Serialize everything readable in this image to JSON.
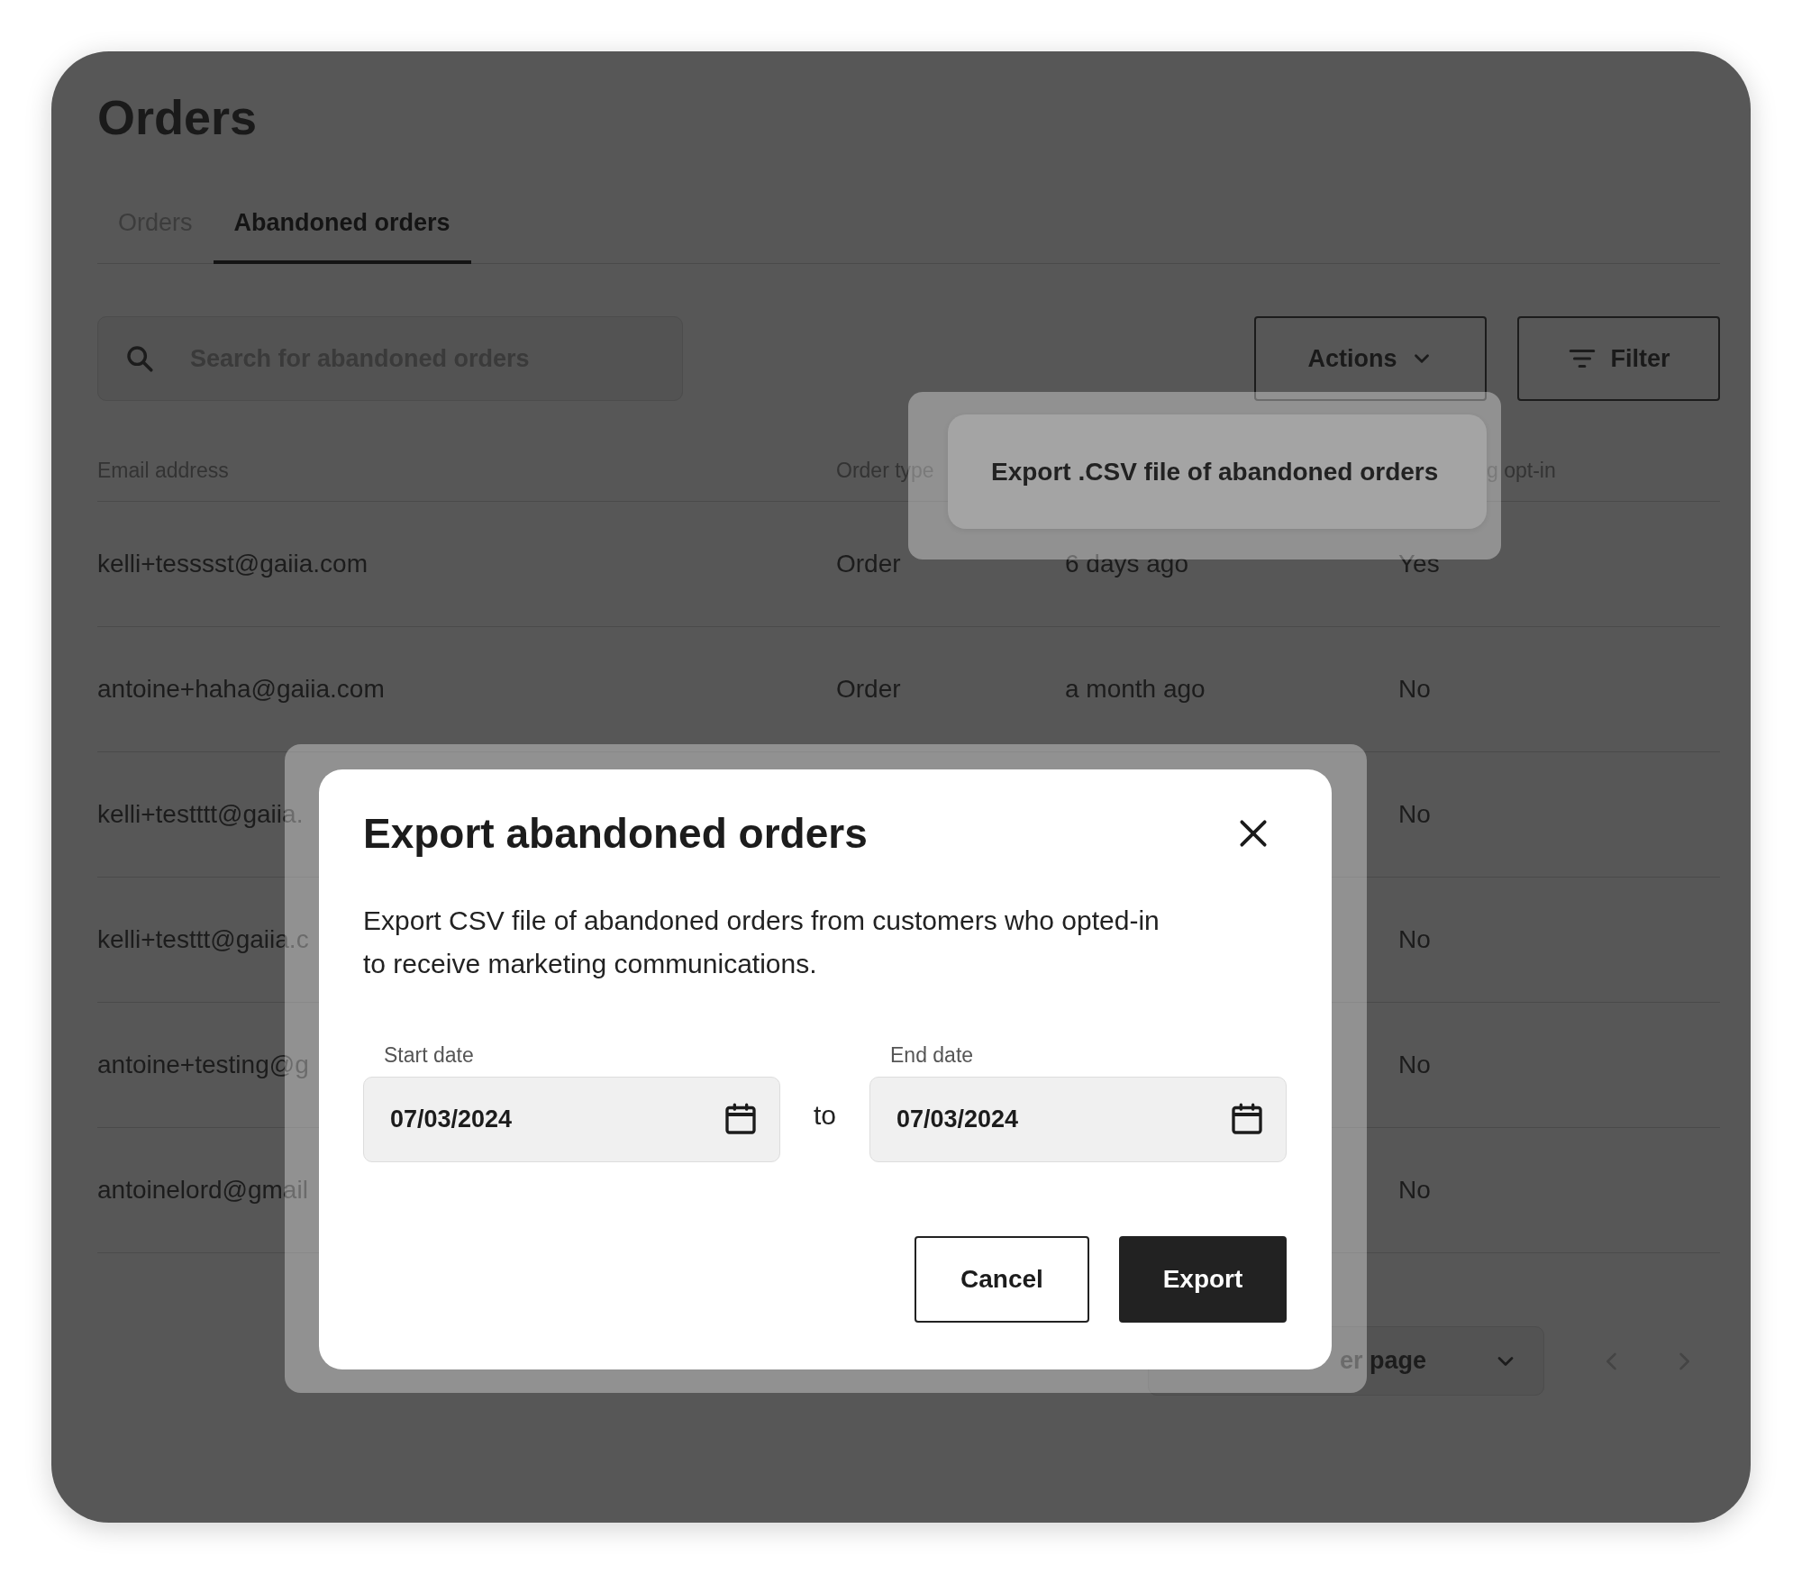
{
  "page": {
    "title": "Orders"
  },
  "tabs": [
    {
      "label": "Orders",
      "selected": false
    },
    {
      "label": "Abandoned orders",
      "selected": true
    }
  ],
  "search": {
    "placeholder": "Search for abandoned orders"
  },
  "toolbar": {
    "actions_button": "Actions",
    "filter_button": "Filter"
  },
  "actions_menu": {
    "items": [
      "Export .CSV file of abandoned orders"
    ]
  },
  "table": {
    "header": {
      "email": "Email address",
      "order_type": "Order type",
      "column_4": "g opt-in"
    },
    "rows": [
      {
        "email": "kelli+tesssst@gaiia.com",
        "order_type": "Order",
        "date": "6 days ago",
        "opt_in": "Yes"
      },
      {
        "email": "antoine+haha@gaiia.com",
        "order_type": "Order",
        "date": "a month ago",
        "opt_in": "No"
      },
      {
        "email": "kelli+testttt@gaiia.",
        "opt_in": "No"
      },
      {
        "email": "kelli+testtt@gaiia.c",
        "opt_in": "No"
      },
      {
        "email": "antoine+testing@g",
        "opt_in": "No"
      },
      {
        "email": "antoinelord@gmail",
        "opt_in": "No"
      }
    ]
  },
  "pagination": {
    "per_page": "er page"
  },
  "dialog": {
    "title": "Export abandoned orders",
    "text": "Export CSV file of abandoned orders from customers who opted-in to receive marketing communications.",
    "start_date": {
      "label": "Start date",
      "value": "07/03/2024"
    },
    "separator": "to",
    "end_date": {
      "label": "End date",
      "value": "07/03/2024"
    },
    "buttons": [
      {
        "label": "Cancel",
        "kind": "secondary"
      },
      {
        "label": "Export",
        "kind": "primary"
      }
    ]
  }
}
